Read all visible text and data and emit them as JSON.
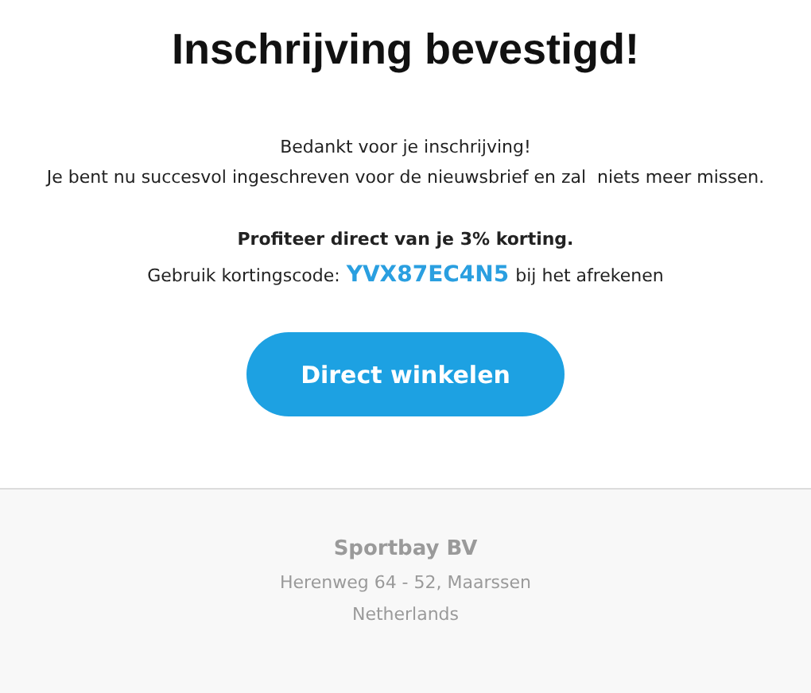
{
  "title": "Inschrijving bevestigd!",
  "message": [
    "Bedankt voor je inschrijving!",
    "Je bent nu succesvol ingeschreven voor de nieuwsbrief en zal  niets meer missen."
  ],
  "offer": "Profiteer direct van je 3% korting.",
  "code_line": {
    "prefix": "Gebruik kortingscode:",
    "code": "YVX87EC4N5",
    "suffix": "bij het afrekenen"
  },
  "button": "Direct winkelen",
  "footer": {
    "company": "Sportbay BV",
    "address": "Herenweg 64 - 52, Maarssen",
    "country": "Netherlands"
  }
}
